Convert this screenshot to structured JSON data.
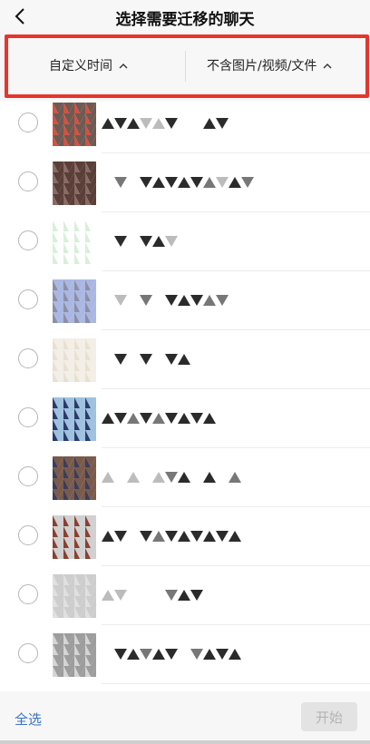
{
  "nav": {
    "title": "选择需要迁移的聊天"
  },
  "filters": {
    "time_label": "自定义时间",
    "type_label": "不含图片/视频/文件"
  },
  "chats": [
    {
      "name_pattern": [
        "d",
        "d",
        "d",
        "l",
        "l",
        "d",
        "x",
        "x",
        "d",
        "d"
      ]
    },
    {
      "name_pattern": [
        "x",
        "m",
        "x",
        "d",
        "d",
        "d",
        "d",
        "d",
        "m",
        "l",
        "d",
        "m"
      ]
    },
    {
      "name_pattern": [
        "x",
        "d",
        "x",
        "d",
        "d",
        "l"
      ]
    },
    {
      "name_pattern": [
        "x",
        "l",
        "x",
        "m",
        "x",
        "d",
        "d",
        "d",
        "m",
        "m"
      ]
    },
    {
      "name_pattern": [
        "x",
        "d",
        "x",
        "d",
        "x",
        "d",
        "d"
      ]
    },
    {
      "name_pattern": [
        "d",
        "d",
        "m",
        "d",
        "m",
        "d",
        "d",
        "d",
        "d"
      ]
    },
    {
      "name_pattern": [
        "l",
        "x",
        "l",
        "x",
        "l",
        "m",
        "d",
        "x",
        "d",
        "x",
        "m"
      ]
    },
    {
      "name_pattern": [
        "d",
        "d",
        "x",
        "d",
        "m",
        "d",
        "d",
        "d",
        "d",
        "d",
        "d"
      ]
    },
    {
      "name_pattern": [
        "l",
        "l",
        "x",
        "x",
        "x",
        "m",
        "d",
        "d"
      ]
    },
    {
      "name_pattern": [
        "x",
        "d",
        "d",
        "m",
        "d",
        "d",
        "x",
        "m",
        "d",
        "d",
        "d"
      ]
    }
  ],
  "footer": {
    "select_all_label": "全选",
    "start_label": "开始"
  },
  "colors": {
    "highlight_border": "#e8352b",
    "link": "#3a73c4",
    "disabled_button_bg": "#e3e3e3"
  },
  "icons": {
    "back": "chevron-left-icon",
    "caret": "chevron-up-icon"
  }
}
